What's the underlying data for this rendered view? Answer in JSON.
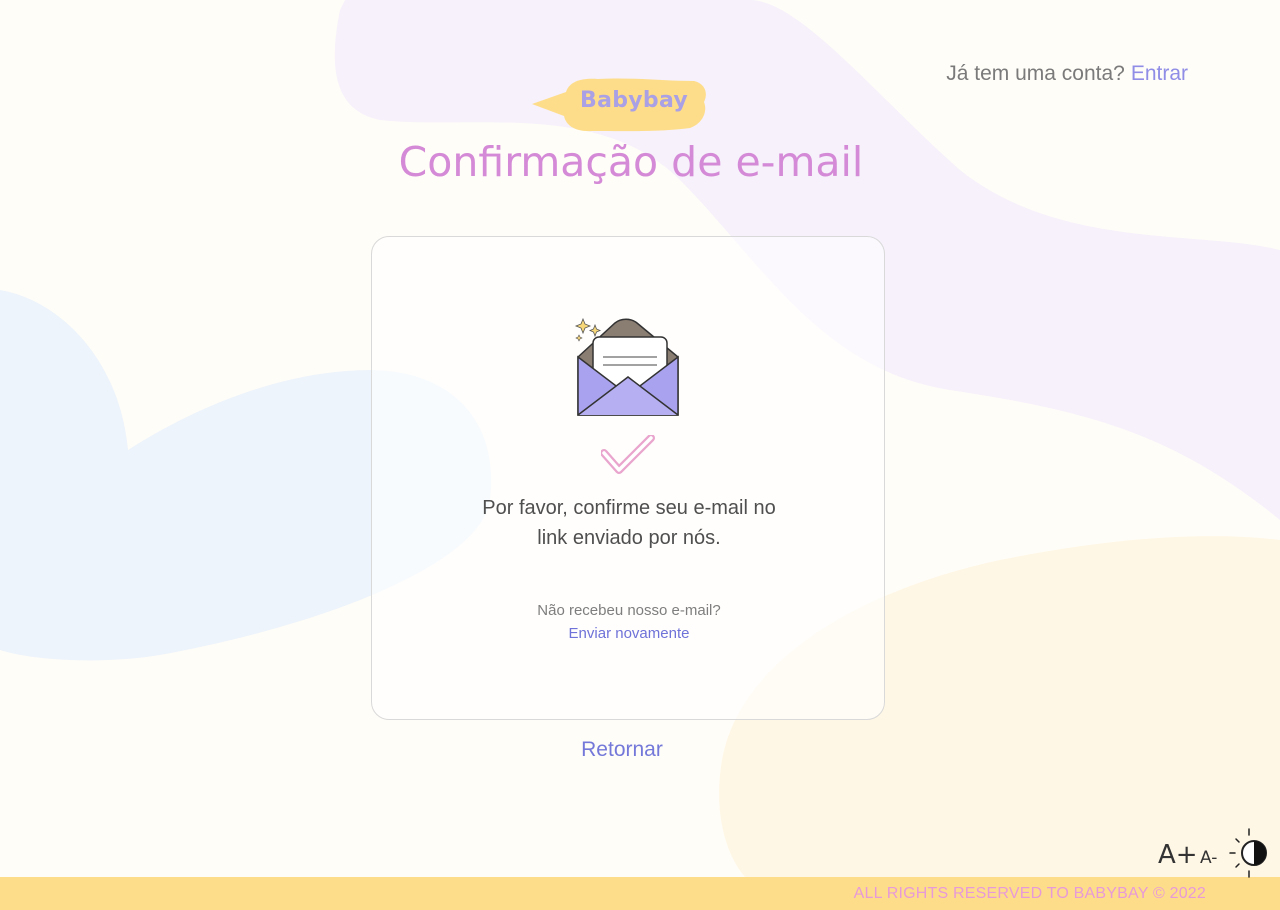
{
  "header": {
    "account_question": "Já tem uma conta?",
    "login_link": "Entrar"
  },
  "logo": {
    "text": "Babybay"
  },
  "page": {
    "title": "Confirmação de e-mail"
  },
  "card": {
    "message_line1": "Por favor, confirme seu e-mail no",
    "message_line2": "link enviado por nós.",
    "not_received": "Não recebeu nosso e-mail?",
    "resend_link": "Enviar novamente"
  },
  "back_link": "Retornar",
  "accessibility": {
    "font_increase": "A+",
    "font_decrease": "A-",
    "contrast_icon": "contrast-icon"
  },
  "footer": {
    "text": "ALL RIGHTS RESERVED TO BABYBAY © 2022"
  },
  "colors": {
    "background": "#fffdf8",
    "title": "#d48ad6",
    "link": "#8f8de6",
    "logo_bubble": "#fedd8a",
    "footer": "#fedd8a",
    "footer_text": "#e79ad8",
    "envelope": "#a9a3ef",
    "check": "#e9a5cd"
  }
}
